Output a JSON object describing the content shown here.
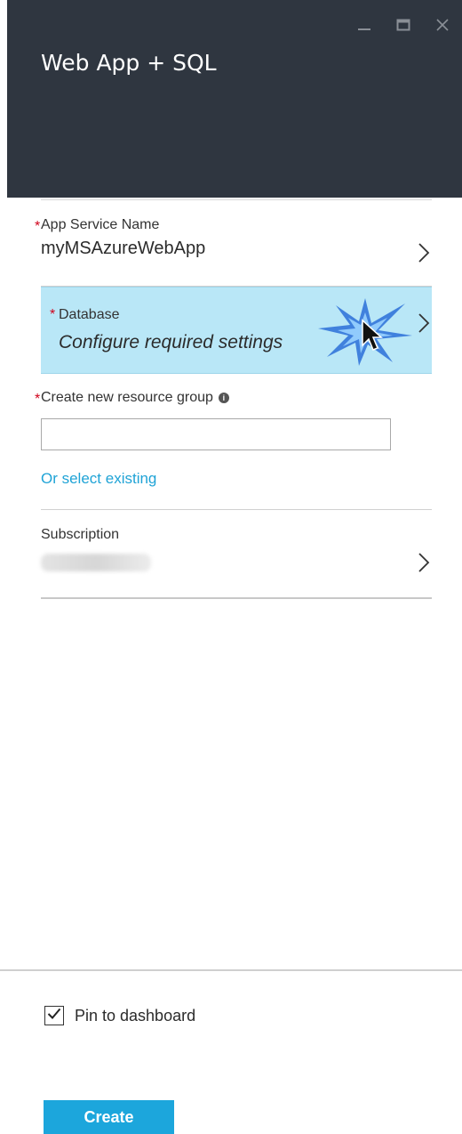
{
  "window": {
    "title": "Web App + SQL",
    "controls": {
      "minimize_icon": "minimize-icon",
      "maximize_icon": "maximize-icon",
      "close_icon": "close-icon"
    }
  },
  "form": {
    "app_service": {
      "label": "App Service Name",
      "value": "myMSAzureWebApp",
      "required": true
    },
    "database": {
      "label": "Database",
      "value": "Configure required settings",
      "required": true
    },
    "resource_group": {
      "label": "Create new resource group",
      "input_value": "",
      "link": "Or select existing",
      "required": true
    },
    "subscription": {
      "label": "Subscription"
    }
  },
  "footer": {
    "pin_label": "Pin to dashboard",
    "pin_checked": true,
    "create_label": "Create"
  },
  "colors": {
    "titlebar": "#2f3640",
    "highlight": "#b9e7f7",
    "accent": "#1ca6dc",
    "link": "#1fa3d6",
    "required": "#d0021b"
  }
}
